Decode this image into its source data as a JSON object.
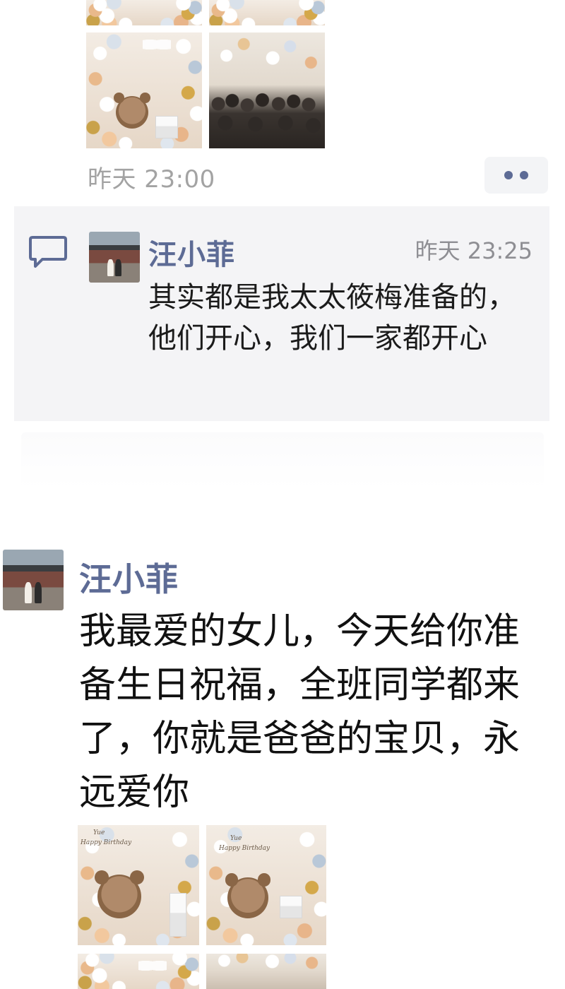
{
  "previous_post": {
    "timestamp": "昨天 23:00",
    "more_icon": "more-dots-icon"
  },
  "comment": {
    "icon": "comment-icon",
    "author": "汪小菲",
    "time": "昨天 23:25",
    "text": "其实都是我太太筱梅准备的，他们开心，我们一家都开心"
  },
  "post": {
    "author": "汪小菲",
    "text": "我最爱的女儿，今天给你准备生日祝福，全班同学都来了，你就是爸爸的宝贝，永远爱你"
  },
  "photo_captions": {
    "yue": "Yue",
    "happy_birthday": "Happy Birthday"
  },
  "colors": {
    "name_blue": "#5d6b95",
    "timestamp_gray": "#a3a3a3",
    "panel_bg": "#f4f4f6"
  }
}
